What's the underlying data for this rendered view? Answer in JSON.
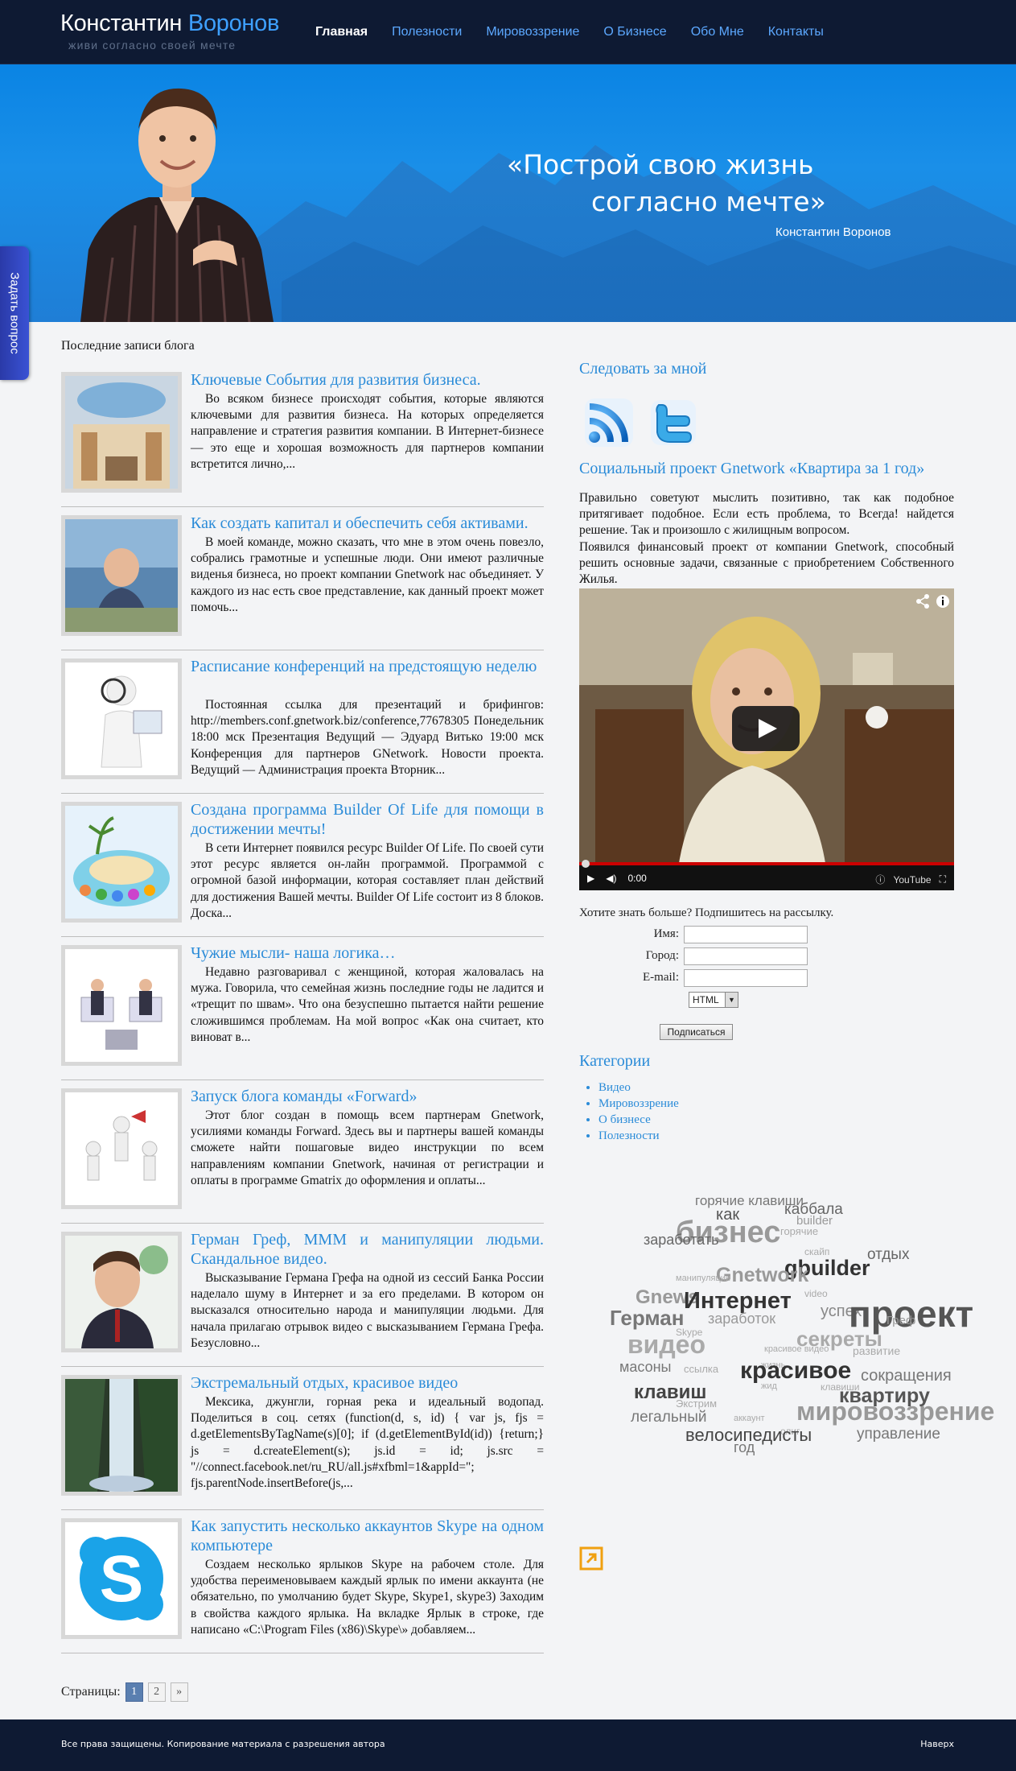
{
  "header": {
    "logo_first": "Константин",
    "logo_last": "Воронов",
    "tagline": "живи согласно своей мечте",
    "nav": [
      "Главная",
      "Полезности",
      "Мировоззрение",
      "О Бизнесе",
      "Обо Мне",
      "Контакты"
    ]
  },
  "hero": {
    "quote_line1": "«Построй свою жизнь",
    "quote_line2": "согласно мечте»",
    "author": "Константин Воронов"
  },
  "ask_tab": "Задать вопрос",
  "blog": {
    "title": "Последние записи блога",
    "posts": [
      {
        "title": "Ключевые События для развития бизнеса.",
        "text": "Во всяком бизнесе происходят события, которые являются ключевыми для развития бизнеса. На которых определяется направление и стратегия развития компании. В Интернет-бизнесе — это еще и хорошая возможность для партнеров компании встретится лично,..."
      },
      {
        "title": "Как создать капитал и обеспечить себя активами.",
        "text": "В моей команде, можно сказать, что мне в этом очень повезло, собрались грамотные и успешные люди. Они имеют различные виденья бизнеса, но проект компании Gnetwork нас объединяет.  У каждого из нас есть свое представление, как данный проект может помочь..."
      },
      {
        "title": "Расписание конференций на предстоящую неделю",
        "text": "Постоянная ссылка для презентаций и брифингов: http://members.conf.gnetwork.biz/conference,77678305 Понедельник 18:00 мск Презентация Ведущий — Эдуард Витько     19:00 мск Конференция для партнеров GNetwork. Новости проекта. Ведущий — Администрация проекта  Вторник..."
      },
      {
        "title": "Создана программа Builder Of Life для помощи в достижении мечты!",
        "text": "В сети Интернет появился ресурс Builder Of Life. По своей сути этот ресурс является он-лайн программой. Программой с огромной базой информации, которая составляет план действий для достижения Вашей мечты. Builder Of  Life состоит из 8 блоков.  Доска..."
      },
      {
        "title": "Чужие мысли- наша логика…",
        "text": "Недавно разговаривал с женщиной, которая жаловалась на мужа. Говорила, что семейная жизнь последние годы не ладится и «трещит по швам». Что она безуспешно пытается найти решение сложившимся проблемам. На мой вопрос «Как она считает, кто виноват в..."
      },
      {
        "title": "Запуск блога команды «Forward»",
        "text": "Этот блог создан в помощь всем партнерам Gnetwork, усилиями команды Forward. Здесь вы и партнеры вашей команды сможете найти пошаговые видео инструкции по всем направлениям компании Gnetwork, начиная от регистрации и оплаты в программе Gmatrix до оформления и оплаты..."
      },
      {
        "title": "Герман Греф, МММ и манипуляции людьми. Скандальное видео.",
        "text": "Высказывание Германа Грефа на одной из сессий Банка России наделало шуму в Интернет и за его пределами. В котором он высказался относительно народа и манипуляции людьми.   Для начала прилагаю отрывок видео с высказыванием Германа Грефа. Безусловно..."
      },
      {
        "title": "Экстремальный отдых, красивое видео",
        "text": "Мексика, джунгли, горная река и идеальный водопад. Поделиться в соц. сетях (function(d, s, id) { var js, fjs = d.getElementsByTagName(s)[0];   if   (d.getElementById(id)) {return;}  js = d.createElement(s);  js.id = id;  js.src = \"//connect.facebook.net/ru_RU/all.js#xfbml=1&appId=\"; fjs.parentNode.insertBefore(js,..."
      },
      {
        "title": "Как запустить несколько аккаунтов Skype на одном компьютере",
        "text": "Создаем несколько ярлыков Skype на рабочем столе. Для удобства переименовываем каждый ярлык по имени аккаунта (не обязательно, по умолчанию будет Skype, Skype1, skype3) Заходим в свойства каждого ярлыка. На вкладке Ярлык в строке, где написано «C:\\Program Files (x86)\\Skype\\» добавляем..."
      }
    ],
    "pager_label": "Страницы:",
    "pages": [
      "1",
      "2",
      "»"
    ]
  },
  "sidebar": {
    "follow_title": "Следовать за мной",
    "project_title": "Социальный проект Gnetwork «Квартира за 1 год»",
    "project_p1": "Правильно советуют мыслить позитивно, так как подобное притягивает подобное. Если есть проблема, то Всегда! найдется решение. Так и произошло с жилищным вопросом.",
    "project_p2": "Появился финансовый проект от компании Gnetwork, способный решить основные задачи, связанные с приобретением Собственного Жилья.",
    "video_time": "0:00",
    "video_brand": "YouTube",
    "subscribe_title": "Хотите знать больше? Подпишитесь на рассылку.",
    "name_label": "Имя:",
    "city_label": "Город:",
    "email_label": "E-mail:",
    "format_value": "HTML",
    "subscribe_button": "Подписаться",
    "categories_title": "Категории",
    "categories": [
      "Видео",
      "Мировоззрение",
      "О бизнесе",
      "Полезности"
    ],
    "tags": [
      {
        "t": "горячие клавиши",
        "c": "#777"
      },
      {
        "t": "как",
        "c": "#555"
      },
      {
        "t": "каббала",
        "c": "#666"
      },
      {
        "t": "builder",
        "c": "#999"
      },
      {
        "t": "бизнес",
        "c": "#999"
      },
      {
        "t": "горячие",
        "c": "#aaa"
      },
      {
        "t": "заработать",
        "c": "#666"
      },
      {
        "t": "скайп",
        "c": "#aaa"
      },
      {
        "t": "отдых",
        "c": "#666"
      },
      {
        "t": "gbuilder",
        "c": "#333"
      },
      {
        "t": "Gnetwork",
        "c": "#999"
      },
      {
        "t": "манипуляции",
        "c": "#aaa"
      },
      {
        "t": "Gnews",
        "c": "#999"
      },
      {
        "t": "Интернет",
        "c": "#333"
      },
      {
        "t": "video",
        "c": "#aaa"
      },
      {
        "t": "успех",
        "c": "#888"
      },
      {
        "t": "проект",
        "c": "#555"
      },
      {
        "t": "Герман",
        "c": "#777"
      },
      {
        "t": "заработок",
        "c": "#999"
      },
      {
        "t": "Skype",
        "c": "#aaa"
      },
      {
        "t": "Греф",
        "c": "#999"
      },
      {
        "t": "видео",
        "c": "#aaa"
      },
      {
        "t": "красивое видео",
        "c": "#aaa"
      },
      {
        "t": "секреты",
        "c": "#aaa"
      },
      {
        "t": "развитие",
        "c": "#aaa"
      },
      {
        "t": "жизнь",
        "c": "#aaa"
      },
      {
        "t": "масоны",
        "c": "#777"
      },
      {
        "t": "ссылка",
        "c": "#aaa"
      },
      {
        "t": "красивое",
        "c": "#333"
      },
      {
        "t": "сокращения",
        "c": "#777"
      },
      {
        "t": "жид",
        "c": "#aaa"
      },
      {
        "t": "клавиши",
        "c": "#aaa"
      },
      {
        "t": "клавиш",
        "c": "#444"
      },
      {
        "t": "квартиру",
        "c": "#555"
      },
      {
        "t": "Экстрим",
        "c": "#aaa"
      },
      {
        "t": "мировоззрение",
        "c": "#999"
      },
      {
        "t": "легальный",
        "c": "#777"
      },
      {
        "t": "аккаунт",
        "c": "#aaa"
      },
      {
        "t": "олиг",
        "c": "#aaa"
      },
      {
        "t": "велосипедисты",
        "c": "#444"
      },
      {
        "t": "управление",
        "c": "#777"
      },
      {
        "t": "год",
        "c": "#777"
      }
    ]
  },
  "footer": {
    "copyright": "Все права защищены. Копирование материала с разрешения автора",
    "to_top": "Наверх"
  }
}
